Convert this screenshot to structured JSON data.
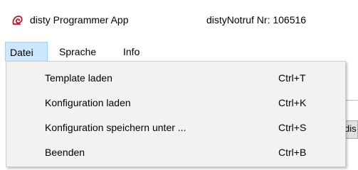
{
  "window": {
    "title": "disty Programmer App",
    "notruf": "distyNotruf Nr:  106516",
    "icon": "disty-logo-icon",
    "accent": "#c8102e"
  },
  "menubar": {
    "items": [
      {
        "label": "Datei"
      },
      {
        "label": "Sprache"
      },
      {
        "label": "Info"
      }
    ]
  },
  "background": {
    "partial_text": "dis"
  },
  "dropdown": {
    "items": [
      {
        "label": "Template laden",
        "shortcut": "Ctrl+T"
      },
      {
        "label": "Konfiguration laden",
        "shortcut": "Ctrl+K"
      },
      {
        "label": "Konfiguration speichern unter ...",
        "shortcut": "Ctrl+S"
      },
      {
        "label": "Beenden",
        "shortcut": "Ctrl+B"
      }
    ]
  }
}
